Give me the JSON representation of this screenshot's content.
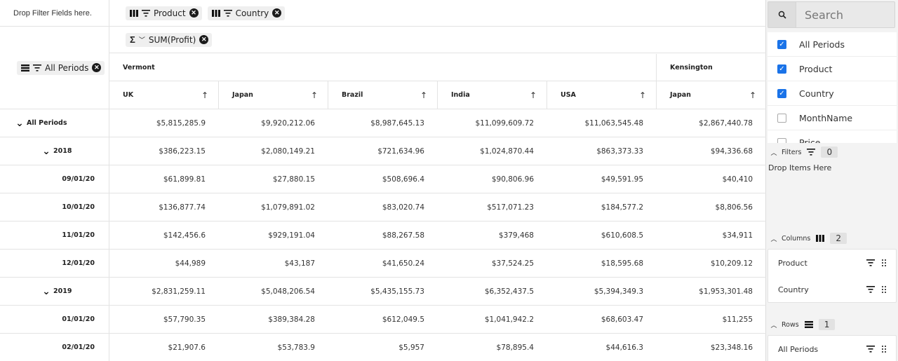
{
  "pivot": {
    "filter_drop_text": "Drop Filter Fields here.",
    "column_chips": [
      {
        "label": "Product"
      },
      {
        "label": "Country"
      }
    ],
    "value_chip": {
      "label": "SUM(Profit)"
    },
    "row_chip": {
      "label": "All Periods"
    },
    "column_groups": [
      {
        "label": "Vermont"
      },
      {
        "label": "Kensington"
      }
    ],
    "columns": [
      "UK",
      "Japan",
      "Brazil",
      "India",
      "USA",
      "Japan"
    ],
    "rows": [
      {
        "label": "All Periods",
        "level": 0,
        "values": [
          "$5,815,285.9",
          "$9,920,212.06",
          "$8,987,645.13",
          "$11,099,609.72",
          "$11,063,545.48",
          "$2,867,440.78"
        ]
      },
      {
        "label": "2018",
        "level": 1,
        "values": [
          "$386,223.15",
          "$2,080,149.21",
          "$721,634.96",
          "$1,024,870.44",
          "$863,373.33",
          "$94,336.68"
        ]
      },
      {
        "label": "09/01/20",
        "level": 2,
        "values": [
          "$61,899.81",
          "$27,880.15",
          "$508,696.4",
          "$90,806.96",
          "$49,591.95",
          "$40,410"
        ]
      },
      {
        "label": "10/01/20",
        "level": 2,
        "values": [
          "$136,877.74",
          "$1,079,891.02",
          "$83,020.74",
          "$517,071.23",
          "$184,577.2",
          "$8,806.56"
        ]
      },
      {
        "label": "11/01/20",
        "level": 2,
        "values": [
          "$142,456.6",
          "$929,191.04",
          "$88,267.58",
          "$379,468",
          "$610,608.5",
          "$34,911"
        ]
      },
      {
        "label": "12/01/20",
        "level": 2,
        "values": [
          "$44,989",
          "$43,187",
          "$41,650.24",
          "$37,524.25",
          "$18,595.68",
          "$10,209.12"
        ]
      },
      {
        "label": "2019",
        "level": 1,
        "values": [
          "$2,831,259.11",
          "$5,048,206.54",
          "$5,435,155.73",
          "$6,352,437.5",
          "$5,394,349.3",
          "$1,953,301.48"
        ]
      },
      {
        "label": "01/01/20",
        "level": 2,
        "values": [
          "$57,790.35",
          "$389,384.28",
          "$612,049.5",
          "$1,041,942.2",
          "$68,603.47",
          "$11,255"
        ]
      },
      {
        "label": "02/01/20",
        "level": 2,
        "values": [
          "$21,907.6",
          "$53,783.9",
          "$5,957",
          "$78,895.4",
          "$44,616.3",
          "$23,348.16"
        ]
      }
    ]
  },
  "panel": {
    "search_placeholder": "Search",
    "fields": [
      {
        "label": "All Periods",
        "checked": true
      },
      {
        "label": "Product",
        "checked": true
      },
      {
        "label": "Country",
        "checked": true
      },
      {
        "label": "MonthName",
        "checked": false
      },
      {
        "label": "Price",
        "checked": false
      }
    ],
    "filters": {
      "label": "Filters",
      "count": "0",
      "drop_text": "Drop Items Here"
    },
    "columns": {
      "label": "Columns",
      "count": "2",
      "items": [
        "Product",
        "Country"
      ]
    },
    "rows": {
      "label": "Rows",
      "count": "1",
      "items": [
        "All Periods"
      ]
    },
    "colors": {
      "accent": "#1a73e8",
      "panel_bg": "#f3f3f3"
    }
  }
}
